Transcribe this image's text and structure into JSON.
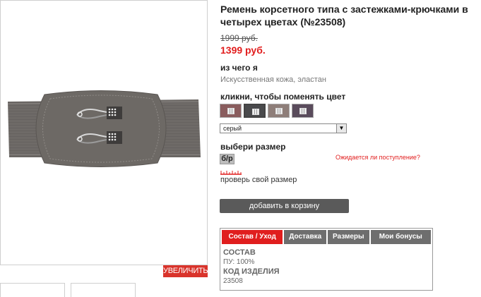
{
  "product": {
    "title": "Ремень корсетного типа с застежками-крючками в четырех цветах (№23508)",
    "old_price": "1999 руб.",
    "new_price": "1399 руб."
  },
  "gallery": {
    "zoom_label": "УВЕЛИЧИТЬ"
  },
  "material": {
    "label": "из чего я",
    "value": "Искусственная кожа, эластан"
  },
  "color": {
    "label": "кликни, чтобы поменять цвет",
    "swatches": [
      {
        "color": "#8a5d5e"
      },
      {
        "color": "#4a4a4c"
      },
      {
        "color": "#8e7e79"
      },
      {
        "color": "#5a4c5c"
      }
    ],
    "selected": "серый",
    "arrow": "▼"
  },
  "size": {
    "label": "выбери размер",
    "option": "б/р",
    "expected_link": "Ожидается ли поступление?",
    "check_link": "проверь свой размер"
  },
  "cart": {
    "button": "добавить в корзину"
  },
  "tabs": {
    "items": [
      {
        "label": "Состав / Уход"
      },
      {
        "label": "Доставка"
      },
      {
        "label": "Размеры"
      },
      {
        "label": "Мои бонусы"
      }
    ]
  },
  "composition": {
    "heading": "СОСТАВ",
    "value": "ПУ: 100%",
    "code_heading": "КОД ИЗДЕЛИЯ",
    "code_value": "23508"
  },
  "colors": {
    "accent": "#e01e1e",
    "button": "#5a5a5a",
    "belt": "#6e6a67"
  }
}
